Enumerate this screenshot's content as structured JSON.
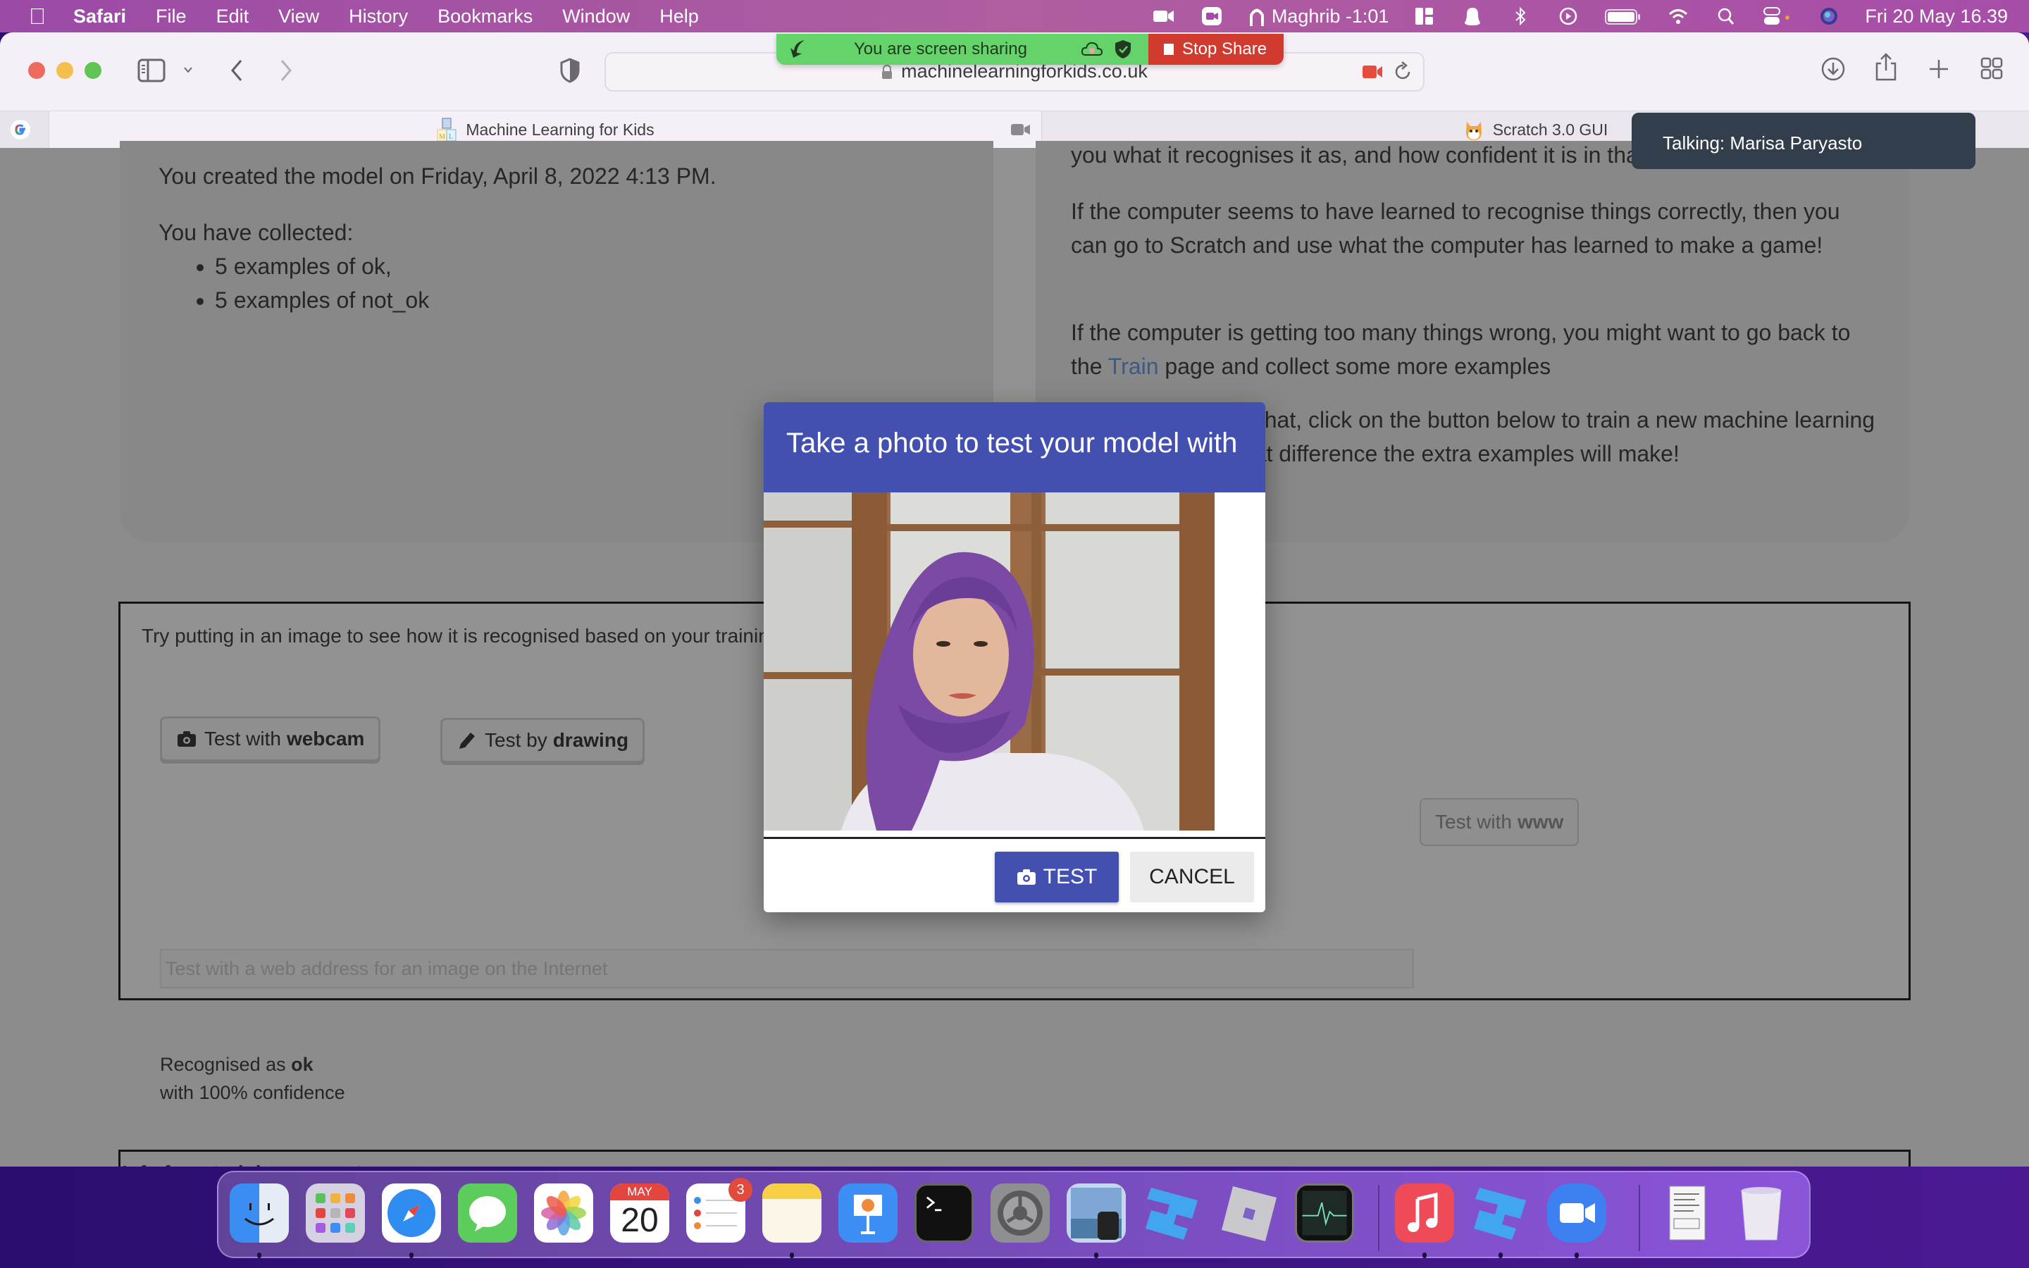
{
  "menubar": {
    "app_name": "Safari",
    "menus": [
      "File",
      "Edit",
      "View",
      "History",
      "Bookmarks",
      "Window",
      "Help"
    ],
    "status": {
      "prayer": "Maghrib -1:01",
      "datetime": "Fri 20 May  16.39"
    }
  },
  "browser": {
    "url": "machinelearningforkids.co.uk",
    "tabs": [
      {
        "label": "",
        "icon": "google-icon"
      },
      {
        "label": "Machine Learning for Kids",
        "icon": "ml-icon"
      },
      {
        "label": "Scratch 3.0 GUI",
        "icon": "scratch-cat-icon"
      }
    ]
  },
  "zoom": {
    "sharing_label": "You are screen sharing",
    "stop_share_label": "Stop Share",
    "talking_label": "Talking: Marisa Paryasto"
  },
  "page": {
    "left_panel": {
      "created": "You created the model on Friday, April 8, 2022 4:13 PM.",
      "collected_label": "You have collected:",
      "examples": [
        "5 examples of ok,",
        "5 examples of not_ok"
      ]
    },
    "right_panel": {
      "p0": "you what it recognises it as, and how confident it is in that.",
      "p1": "If the computer seems to have learned to recognise things correctly, then you can go to Scratch and use what the computer has learned to make a game!",
      "p2_before": "If the computer is getting too many things wrong, you might want to go back to the ",
      "p2_link": "Train",
      "p2_after": " page and collect some more examples",
      "p3": "Once you've done that, click on the button below to train a new machine learning model and see what difference the extra examples will make!"
    },
    "test": {
      "intro": "Try putting in an image to see how it is recognised based on your training.",
      "webcam_prefix": "Test with",
      "webcam_bold": "webcam",
      "drawing_prefix": "Test by",
      "drawing_bold": "drawing",
      "url_placeholder": "Test with a web address for an image on the Internet",
      "www_prefix": "Test with",
      "www_bold": "www",
      "result_prefix": "Recognised as",
      "result_label": "ok",
      "result_confidence": "with 100% confidence"
    },
    "info_label": "Info from training computer:"
  },
  "modal": {
    "title": "Take a photo to test your model with",
    "test_label": "TEST",
    "cancel_label": "CANCEL",
    "accent": "#4350af"
  },
  "dock": {
    "calendar_month": "MAY",
    "calendar_day": "20",
    "reminders_badge": "3",
    "apps": [
      "Finder",
      "Launchpad",
      "Safari",
      "Messages",
      "Photos",
      "Calendar",
      "Reminders",
      "Notes",
      "Keynote",
      "Terminal",
      "System Preferences",
      "Preview",
      "Roblox Studio",
      "Roblox",
      "Activity Monitor",
      "Music",
      "Roblox Studio",
      "Zoom",
      "Document",
      "Trash"
    ]
  }
}
